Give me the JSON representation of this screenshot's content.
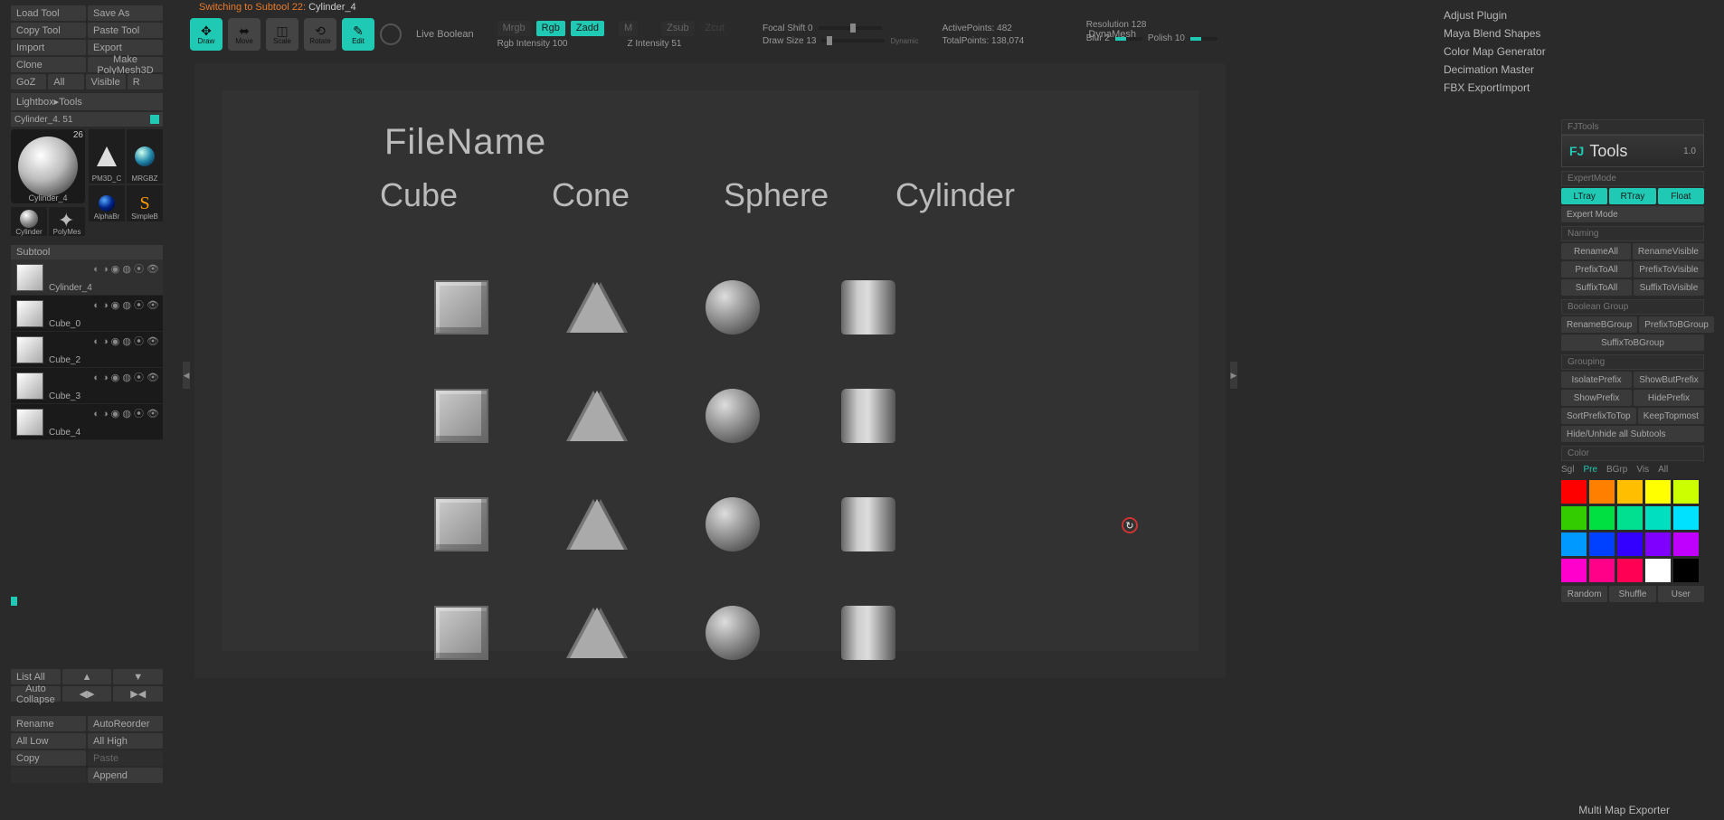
{
  "switching": {
    "prefix": "Switching to Subtool 22:",
    "name": "Cylinder_4"
  },
  "left": {
    "load": "Load Tool",
    "save": "Save As",
    "copy": "Copy Tool",
    "paste": "Paste Tool",
    "import": "Import",
    "export": "Export",
    "clone": "Clone",
    "makepoly": "Make PolyMesh3D",
    "goz": "GoZ",
    "all": "All",
    "visible": "Visible",
    "r": "R",
    "lightbox": "Lightbox▸Tools",
    "active": "Cylinder_4. 51",
    "big": {
      "num": "26",
      "name": "Cylinder_4"
    },
    "cells": [
      "PM3D_C",
      "MRGBZ",
      "AlphaBr",
      "SimpleB"
    ],
    "small": [
      "Cylinder",
      "PolyMes"
    ],
    "subtool_head": "Subtool",
    "subtools": [
      "Cylinder_4",
      "Cube_0",
      "Cube_2",
      "Cube_3",
      "Cube_4"
    ],
    "listall": "List All",
    "autocoll": "Auto Collapse",
    "rename": "Rename",
    "autoreorder": "AutoReorder",
    "alllow": "All Low",
    "allhigh": "All High",
    "copy2": "Copy",
    "paste2": "Paste",
    "append": "Append"
  },
  "top": {
    "draw": "Draw",
    "move": "Move",
    "scale": "Scale",
    "rotate": "Rotate",
    "edit": "Edit",
    "livebool": "Live Boolean",
    "mrgb": "Mrgb",
    "rgb": "Rgb",
    "zadd": "Zadd",
    "m": "M",
    "zsub": "Zsub",
    "zcut": "Zcut",
    "rgbint": "Rgb Intensity 100",
    "zint": "Z Intensity 51",
    "focal": "Focal Shift 0",
    "drawsize": "Draw Size 13",
    "dynamic": "Dynamic",
    "active": "ActivePoints: 482",
    "total": "TotalPoints: 138,074",
    "dynamesh": "DynaMesh",
    "res": "Resolution 128",
    "blur": "Blur 2",
    "polish": "Polish 10"
  },
  "canvas": {
    "filename": "FileName",
    "cols": [
      "Cube",
      "Cone",
      "Sphere",
      "Cylinder"
    ]
  },
  "plugins": [
    "Adjust Plugin",
    "Maya Blend Shapes",
    "Color Map Generator",
    "Decimation Master",
    "FBX ExportImport"
  ],
  "fj": {
    "pre": "FJTools",
    "title": "Tools",
    "ver": "1.0",
    "expertmode_lbl": "ExpertMode",
    "ltray": "LTray",
    "rtray": "RTray",
    "float": "Float",
    "expert": "Expert Mode",
    "naming_lbl": "Naming",
    "renameall": "RenameAll",
    "renamevis": "RenameVisible",
    "prefall": "PrefixToAll",
    "prefvis": "PrefixToVisible",
    "sufall": "SuffixToAll",
    "sufvis": "SuffixToVisible",
    "bool_lbl": "Boolean Group",
    "renamebg": "RenameBGroup",
    "prefbg": "PrefixToBGroup",
    "sufbg": "SuffixToBGroup",
    "group_lbl": "Grouping",
    "isopref": "IsolatePrefix",
    "showbut": "ShowButPrefix",
    "showpref": "ShowPrefix",
    "hidepref": "HidePrefix",
    "sortpref": "SortPrefixToTop",
    "keeptop": "KeepTopmost",
    "hideun": "Hide/Unhide all Subtools",
    "color_lbl": "Color",
    "ctabs": [
      "Sgl",
      "Pre",
      "BGrp",
      "Vis",
      "All"
    ],
    "random": "Random",
    "shuffle": "Shuffle",
    "user": "User"
  },
  "multimap": "Multi Map Exporter",
  "colors": [
    "#ff0000",
    "#ff8000",
    "#ffbf00",
    "#ffff00",
    "#ccff00",
    "#33cc00",
    "#00e040",
    "#00e090",
    "#00e0c0",
    "#00e0ff",
    "#0099ff",
    "#0040ff",
    "#3300ff",
    "#8000ff",
    "#bf00ff",
    "#ff00cc",
    "#ff0088",
    "#ff0055",
    "#ffffff",
    "#000000"
  ]
}
